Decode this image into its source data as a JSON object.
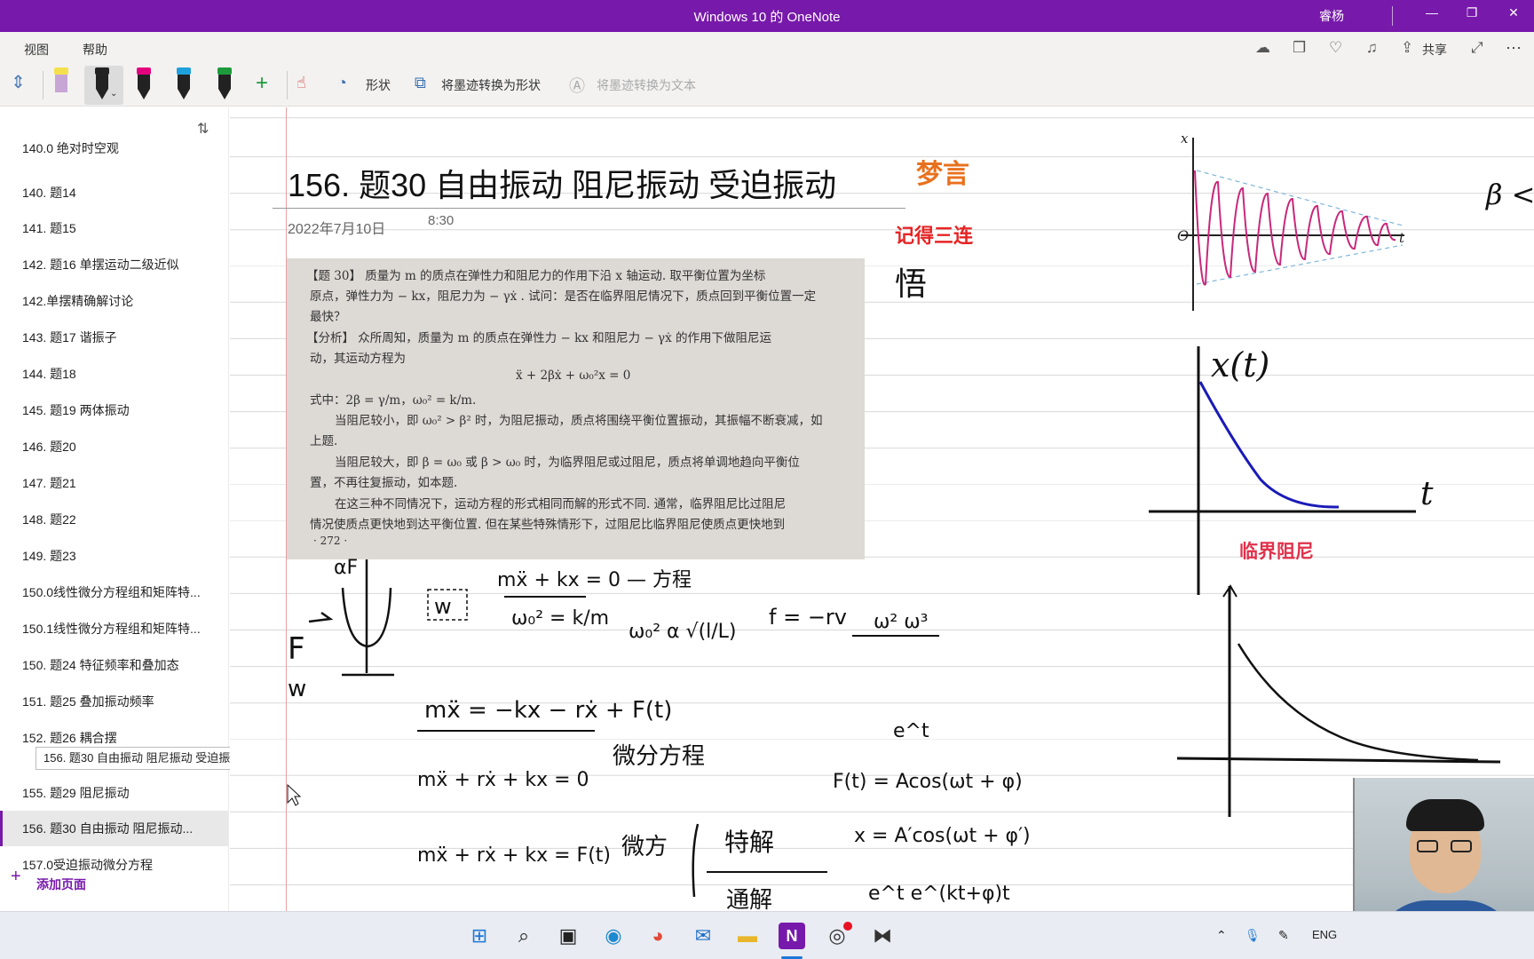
{
  "titlebar": {
    "title": "Windows 10 的 OneNote",
    "user": "睿杨",
    "minimize": "—",
    "restore": "❐",
    "close": "✕"
  },
  "menu": {
    "view": "视图",
    "help": "帮助",
    "share": "共享",
    "more": "···"
  },
  "toolbar": {
    "shapes_label": "形状",
    "ink_to_shape_label": "将墨迹转换为形状",
    "ink_to_text_label": "将墨迹转换为文本",
    "add_pen": "+"
  },
  "pens": [
    {
      "color": "#f4e04d"
    },
    {
      "color": "#222222"
    },
    {
      "color": "#e3007d"
    },
    {
      "color": "#1ea0dc"
    },
    {
      "color": "#1e9a3c"
    }
  ],
  "pages": [
    {
      "label": "140.0 绝对时空观"
    },
    {
      "label": "140.   题14"
    },
    {
      "label": "141.   题15"
    },
    {
      "label": "142.   题16 单摆运动二级近似"
    },
    {
      "label": "142.单摆精确解讨论"
    },
    {
      "label": "143.   题17 谐振子"
    },
    {
      "label": "144.   题18"
    },
    {
      "label": "145.   题19 两体振动"
    },
    {
      "label": "146.   题20"
    },
    {
      "label": "147.   题21"
    },
    {
      "label": "148.   题22"
    },
    {
      "label": "149.   题23"
    },
    {
      "label": "150.0线性微分方程组和矩阵特..."
    },
    {
      "label": "150.1线性微分方程组和矩阵特..."
    },
    {
      "label": "150.   题24 特征频率和叠加态"
    },
    {
      "label": "151.   题25 叠加振动频率"
    },
    {
      "label": "152.   题26 耦合摆"
    },
    {
      "label": "155.   题29 阻尼振动"
    },
    {
      "label": "156.   题30 自由振动 阻尼振动..."
    },
    {
      "label": "157.0受迫振动微分方程"
    }
  ],
  "tooltip": "156.   题30 自由振动 阻尼振动 受迫振动",
  "add_page": "添加页面",
  "page": {
    "title": "156.   题30 自由振动 阻尼振动 受迫振动",
    "date": "2022年7月10日",
    "time": "8:30"
  },
  "scan": {
    "lines": [
      "【题 30】  质量为 m 的质点在弹性力和阻尼力的作用下沿 x 轴运动. 取平衡位置为坐标",
      "原点，弹性力为 − kx，阻尼力为 − γẋ . 试问：是否在临界阻尼情况下，质点回到平衡位置一定",
      "最快？",
      "【分析】  众所周知，质量为 m 的质点在弹性力 − kx 和阻尼力 − γẋ 的作用下做阻尼运",
      "动，其运动方程为",
      "ẍ + 2βẋ + ω₀²x = 0",
      "式中：2β = γ/m，ω₀² = k/m.",
      "当阻尼较小，即 ω₀² > β² 时，为阻尼振动，质点将围绕平衡位置振动，其振幅不断衰减，如",
      "上题.",
      "当阻尼较大，即 β = ω₀ 或 β > ω₀ 时，为临界阻尼或过阻尼，质点将单调地趋向平衡位",
      "置，不再往复振动，如本题.",
      "在这三种不同情况下，运动方程的形式相同而解的形式不同. 通常，临界阻尼比过阻尼",
      "情况使质点更快地到达平衡位置. 但在某些特殊情形下，过阻尼比临界阻尼使质点更快地到",
      "· 272 ·"
    ]
  },
  "ink": {
    "red_top": "梦言",
    "red_remember": "记得三连",
    "black_char": "悟",
    "eq_1": "mẍ + kx = 0 — 方程",
    "eq_2": "ω₀² = k/m",
    "eq_3": "ω₀² α √(l/L)",
    "eq_4": "f = −rv",
    "eq_5": "ω² ω³",
    "eq_6": "mẍ = −kx − rẋ + F(t)",
    "eq_7": "微分方程",
    "eq_8": "mẍ + rẋ + kx = 0",
    "eq_9": "e^t",
    "eq_10": "F(t) = Acos(ωt + φ)",
    "eq_11": "mẍ + rẋ + kx = F(t)",
    "eq_12": "微方",
    "eq_13": "特解",
    "eq_14": "x = A′cos(ωt + φ′)",
    "eq_15": "通解",
    "eq_16": "e^t   e^(kt+φ)t",
    "left_F": "F",
    "left_w": "w",
    "left_alphaF": "αF",
    "left_w_box": "w",
    "right_edge": "β < ω"
  },
  "graphs": {
    "damped": {
      "ylabel": "x",
      "xlabel": "t",
      "origin": "O"
    },
    "critical": {
      "ylabel": "x(t)",
      "xlabel": "t",
      "caption": "临界阻尼"
    }
  },
  "taskbar": {
    "lang": "ENG"
  }
}
